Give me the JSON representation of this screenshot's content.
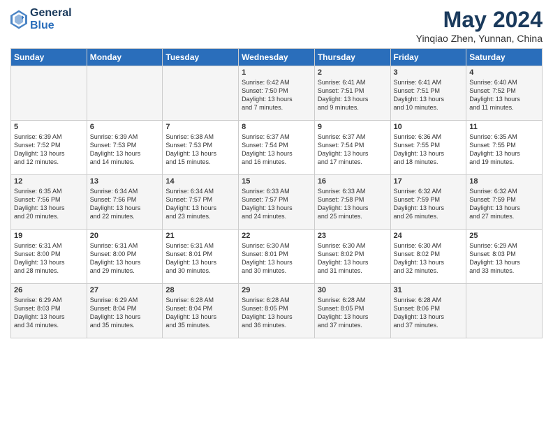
{
  "header": {
    "logo_line1": "General",
    "logo_line2": "Blue",
    "month": "May 2024",
    "location": "Yinqiao Zhen, Yunnan, China"
  },
  "days_of_week": [
    "Sunday",
    "Monday",
    "Tuesday",
    "Wednesday",
    "Thursday",
    "Friday",
    "Saturday"
  ],
  "weeks": [
    [
      {
        "day": "",
        "info": ""
      },
      {
        "day": "",
        "info": ""
      },
      {
        "day": "",
        "info": ""
      },
      {
        "day": "1",
        "info": "Sunrise: 6:42 AM\nSunset: 7:50 PM\nDaylight: 13 hours\nand 7 minutes."
      },
      {
        "day": "2",
        "info": "Sunrise: 6:41 AM\nSunset: 7:51 PM\nDaylight: 13 hours\nand 9 minutes."
      },
      {
        "day": "3",
        "info": "Sunrise: 6:41 AM\nSunset: 7:51 PM\nDaylight: 13 hours\nand 10 minutes."
      },
      {
        "day": "4",
        "info": "Sunrise: 6:40 AM\nSunset: 7:52 PM\nDaylight: 13 hours\nand 11 minutes."
      }
    ],
    [
      {
        "day": "5",
        "info": "Sunrise: 6:39 AM\nSunset: 7:52 PM\nDaylight: 13 hours\nand 12 minutes."
      },
      {
        "day": "6",
        "info": "Sunrise: 6:39 AM\nSunset: 7:53 PM\nDaylight: 13 hours\nand 14 minutes."
      },
      {
        "day": "7",
        "info": "Sunrise: 6:38 AM\nSunset: 7:53 PM\nDaylight: 13 hours\nand 15 minutes."
      },
      {
        "day": "8",
        "info": "Sunrise: 6:37 AM\nSunset: 7:54 PM\nDaylight: 13 hours\nand 16 minutes."
      },
      {
        "day": "9",
        "info": "Sunrise: 6:37 AM\nSunset: 7:54 PM\nDaylight: 13 hours\nand 17 minutes."
      },
      {
        "day": "10",
        "info": "Sunrise: 6:36 AM\nSunset: 7:55 PM\nDaylight: 13 hours\nand 18 minutes."
      },
      {
        "day": "11",
        "info": "Sunrise: 6:35 AM\nSunset: 7:55 PM\nDaylight: 13 hours\nand 19 minutes."
      }
    ],
    [
      {
        "day": "12",
        "info": "Sunrise: 6:35 AM\nSunset: 7:56 PM\nDaylight: 13 hours\nand 20 minutes."
      },
      {
        "day": "13",
        "info": "Sunrise: 6:34 AM\nSunset: 7:56 PM\nDaylight: 13 hours\nand 22 minutes."
      },
      {
        "day": "14",
        "info": "Sunrise: 6:34 AM\nSunset: 7:57 PM\nDaylight: 13 hours\nand 23 minutes."
      },
      {
        "day": "15",
        "info": "Sunrise: 6:33 AM\nSunset: 7:57 PM\nDaylight: 13 hours\nand 24 minutes."
      },
      {
        "day": "16",
        "info": "Sunrise: 6:33 AM\nSunset: 7:58 PM\nDaylight: 13 hours\nand 25 minutes."
      },
      {
        "day": "17",
        "info": "Sunrise: 6:32 AM\nSunset: 7:59 PM\nDaylight: 13 hours\nand 26 minutes."
      },
      {
        "day": "18",
        "info": "Sunrise: 6:32 AM\nSunset: 7:59 PM\nDaylight: 13 hours\nand 27 minutes."
      }
    ],
    [
      {
        "day": "19",
        "info": "Sunrise: 6:31 AM\nSunset: 8:00 PM\nDaylight: 13 hours\nand 28 minutes."
      },
      {
        "day": "20",
        "info": "Sunrise: 6:31 AM\nSunset: 8:00 PM\nDaylight: 13 hours\nand 29 minutes."
      },
      {
        "day": "21",
        "info": "Sunrise: 6:31 AM\nSunset: 8:01 PM\nDaylight: 13 hours\nand 30 minutes."
      },
      {
        "day": "22",
        "info": "Sunrise: 6:30 AM\nSunset: 8:01 PM\nDaylight: 13 hours\nand 30 minutes."
      },
      {
        "day": "23",
        "info": "Sunrise: 6:30 AM\nSunset: 8:02 PM\nDaylight: 13 hours\nand 31 minutes."
      },
      {
        "day": "24",
        "info": "Sunrise: 6:30 AM\nSunset: 8:02 PM\nDaylight: 13 hours\nand 32 minutes."
      },
      {
        "day": "25",
        "info": "Sunrise: 6:29 AM\nSunset: 8:03 PM\nDaylight: 13 hours\nand 33 minutes."
      }
    ],
    [
      {
        "day": "26",
        "info": "Sunrise: 6:29 AM\nSunset: 8:03 PM\nDaylight: 13 hours\nand 34 minutes."
      },
      {
        "day": "27",
        "info": "Sunrise: 6:29 AM\nSunset: 8:04 PM\nDaylight: 13 hours\nand 35 minutes."
      },
      {
        "day": "28",
        "info": "Sunrise: 6:28 AM\nSunset: 8:04 PM\nDaylight: 13 hours\nand 35 minutes."
      },
      {
        "day": "29",
        "info": "Sunrise: 6:28 AM\nSunset: 8:05 PM\nDaylight: 13 hours\nand 36 minutes."
      },
      {
        "day": "30",
        "info": "Sunrise: 6:28 AM\nSunset: 8:05 PM\nDaylight: 13 hours\nand 37 minutes."
      },
      {
        "day": "31",
        "info": "Sunrise: 6:28 AM\nSunset: 8:06 PM\nDaylight: 13 hours\nand 37 minutes."
      },
      {
        "day": "",
        "info": ""
      }
    ]
  ]
}
